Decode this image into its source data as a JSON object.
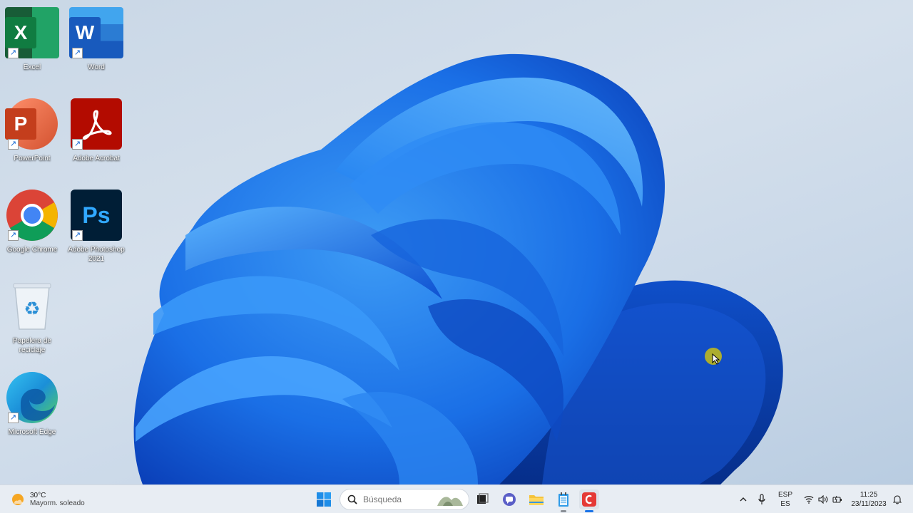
{
  "desktop": {
    "icons": [
      {
        "label": "Excel",
        "glyph": "X",
        "color": "#1e7a45"
      },
      {
        "label": "Word",
        "glyph": "W",
        "color": "#2b66c9"
      },
      {
        "label": "PowerPoint",
        "glyph": "P",
        "color": "#c9432a"
      },
      {
        "label": "Adobe Acrobat",
        "glyph": "acrobat-logo",
        "color": "#b30b00"
      },
      {
        "label": "Google Chrome",
        "glyph": "chrome-logo",
        "color": "#4285f4"
      },
      {
        "label": "Adobe Photoshop 2021",
        "glyph": "Ps",
        "color": "#001e36"
      },
      {
        "label": "Papelera de reciclaje",
        "glyph": "recycle-bin",
        "color": "#2b8fd6"
      },
      {
        "label": "Microsoft Edge",
        "glyph": "edge-logo",
        "color": "#1a8fd6"
      }
    ]
  },
  "taskbar": {
    "weather": {
      "temp": "30°C",
      "desc": "Mayorm. soleado",
      "icon": "sun-cloud-icon"
    },
    "search": {
      "placeholder": "Búsqueda"
    },
    "apps": [
      "start-icon",
      "task-view-icon",
      "teams-chat-icon",
      "file-explorer-icon",
      "notepad-icon",
      "recorder-icon"
    ],
    "tray": {
      "lang_top": "ESP",
      "lang_bottom": "ES",
      "time": "11:25",
      "date": "23/11/2023"
    }
  }
}
